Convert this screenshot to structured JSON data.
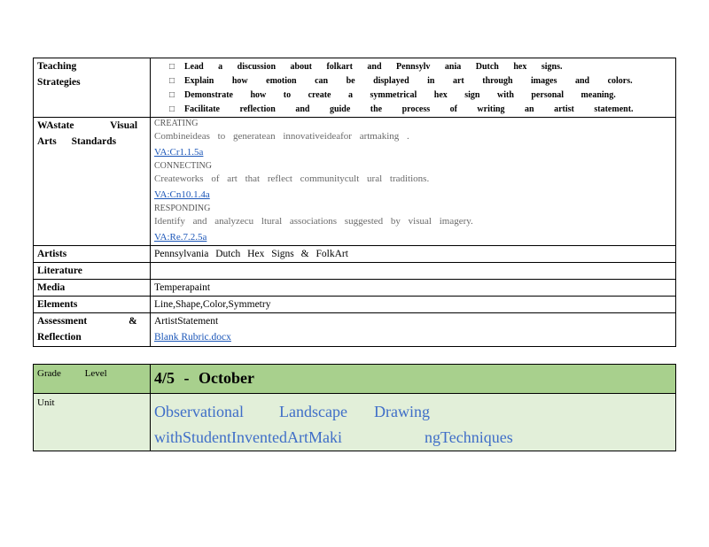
{
  "lesson_table": {
    "teaching_strategies": {
      "label": "Teaching Strategies",
      "bullet_icon": "checkbox-glyph",
      "items": [
        "Lead a discussion about folkart and Pennsylv ania Dutch hex signs.",
        "Explain how emotion can be displayed in art through images and colors.",
        "Demonstrate how to create a symmetrical hex sign with personal meaning.",
        "Facilitate reflection and guide the process of writing an artist statement."
      ]
    },
    "standards": {
      "label_line1": "WAstate Visual",
      "label_line2": "Arts Standards",
      "creating": {
        "heading": "CREATING",
        "desc": "Combineideas to generatean innovativeideafor artmaking .",
        "code": "VA:Cr1.1.5a"
      },
      "connecting": {
        "heading": "CONNECTING",
        "desc": "Createworks of art that reflect communitycult ural traditions.",
        "code": "VA:Cn10.1.4a"
      },
      "responding": {
        "heading": "RESPONDING",
        "desc": "Identify and analyzecu ltural associations suggested by visual imagery.",
        "code": "VA:Re.7.2.5a"
      }
    },
    "artists": {
      "label": "Artists",
      "value": "Pennsylvania Dutch Hex Signs & FolkArt"
    },
    "literature": {
      "label": "Literature",
      "value": ""
    },
    "media": {
      "label": "Media",
      "value": "Temperapaint"
    },
    "elements": {
      "label": "Elements",
      "value": "Line,Shape,Color,Symmetry"
    },
    "assessment": {
      "label_line1": "Assessment &",
      "label_line2": "Reflection",
      "value": "ArtistStatement",
      "link": "Blank Rubric.docx"
    }
  },
  "unit_table": {
    "grade": {
      "label": "Grade Level",
      "value": "4/5 - October"
    },
    "unit": {
      "label": "Unit",
      "line1_words": [
        "Observational",
        "Landscape",
        "Drawing"
      ],
      "line2_part1": "withStudentInventedArtMaki",
      "line2_part2": "ngTechniques"
    }
  },
  "colors": {
    "link": "#1b56b8",
    "grade_row_bg": "#a8d08d",
    "unit_row_bg": "#e2efd9",
    "unit_text": "#3f6ec8"
  }
}
